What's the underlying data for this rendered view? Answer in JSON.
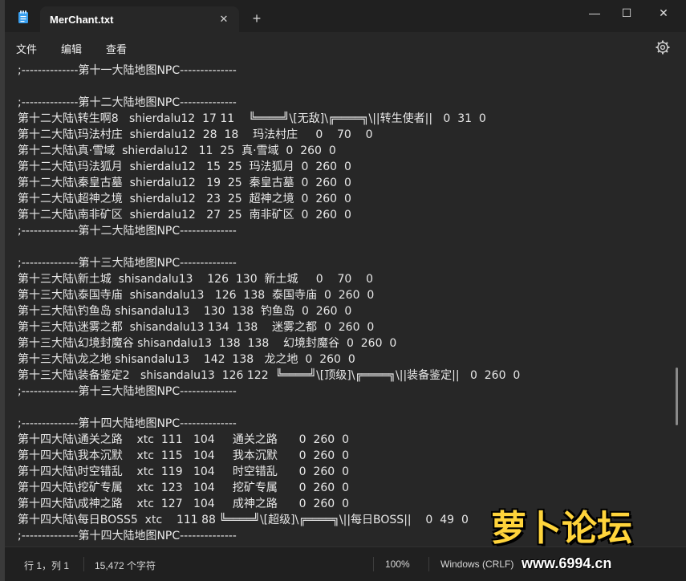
{
  "window": {
    "tab_title": "MerChant.txt",
    "tab_close_glyph": "✕",
    "new_tab_glyph": "+",
    "minimize_glyph": "—",
    "maximize_glyph": "☐",
    "close_glyph": "✕"
  },
  "menu": {
    "file": "文件",
    "edit": "编辑",
    "view": "查看"
  },
  "icons": {
    "app": "notepad-icon",
    "settings": "gear-icon"
  },
  "editor": {
    "lines": [
      ";--------------第十一大陆地图NPC--------------",
      "",
      ";--------------第十二大陆地图NPC--------------",
      "第十二大陆\\转生啊8   shierdalu12  17 11    ╚════╝\\[无敌]\\╔════╗\\||转生使者||   0  31  0",
      "第十二大陆\\玛法村庄  shierdalu12  28  18    玛法村庄     0    70    0",
      "第十二大陆\\真·雪域  shierdalu12   11  25  真·雪域  0  260  0",
      "第十二大陆\\玛法狐月  shierdalu12   15  25  玛法狐月  0  260  0",
      "第十二大陆\\秦皇古墓  shierdalu12   19  25  秦皇古墓  0  260  0",
      "第十二大陆\\超神之境  shierdalu12   23  25  超神之境  0  260  0",
      "第十二大陆\\南非矿区  shierdalu12   27  25  南非矿区  0  260  0",
      ";--------------第十二大陆地图NPC--------------",
      "",
      ";--------------第十三大陆地图NPC--------------",
      "第十三大陆\\新土城  shisandalu13    126  130  新土城     0    70    0",
      "第十三大陆\\泰国寺庙  shisandalu13   126  138  泰国寺庙  0  260  0",
      "第十三大陆\\钓鱼岛 shisandalu13    130  138  钓鱼岛  0  260  0",
      "第十三大陆\\迷雾之都  shisandalu13 134  138    迷雾之都  0  260  0",
      "第十三大陆\\幻境封魔谷 shisandalu13  138  138    幻境封魔谷  0  260  0",
      "第十三大陆\\龙之地 shisandalu13    142  138   龙之地  0  260  0",
      "第十三大陆\\装备鉴定2   shisandalu13  126 122  ╚════╝\\[顶级]\\╔════╗\\||装备鉴定||   0  260  0",
      ";--------------第十三大陆地图NPC--------------",
      "",
      ";--------------第十四大陆地图NPC--------------",
      "第十四大陆\\通关之路    xtc  111   104     通关之路      0  260  0",
      "第十四大陆\\我本沉默    xtc  115   104     我本沉默      0  260  0",
      "第十四大陆\\时空错乱    xtc  119   104     时空错乱      0  260  0",
      "第十四大陆\\挖矿专属    xtc  123   104     挖矿专属      0  260  0",
      "第十四大陆\\成神之路    xtc  127   104     成神之路      0  260  0",
      "第十四大陆\\每日BOSS5  xtc    111 88 ╚════╝\\[超级]\\╔════╗\\||每日BOSS||    0  49  0",
      ";--------------第十四大陆地图NPC--------------"
    ]
  },
  "status": {
    "position": "行 1，列 1",
    "char_count": "15,472 个字符",
    "zoom": "100%",
    "eol": "Windows (CRLF)"
  },
  "watermark": {
    "title": "萝卜论坛",
    "url": "www.6994.cn"
  }
}
